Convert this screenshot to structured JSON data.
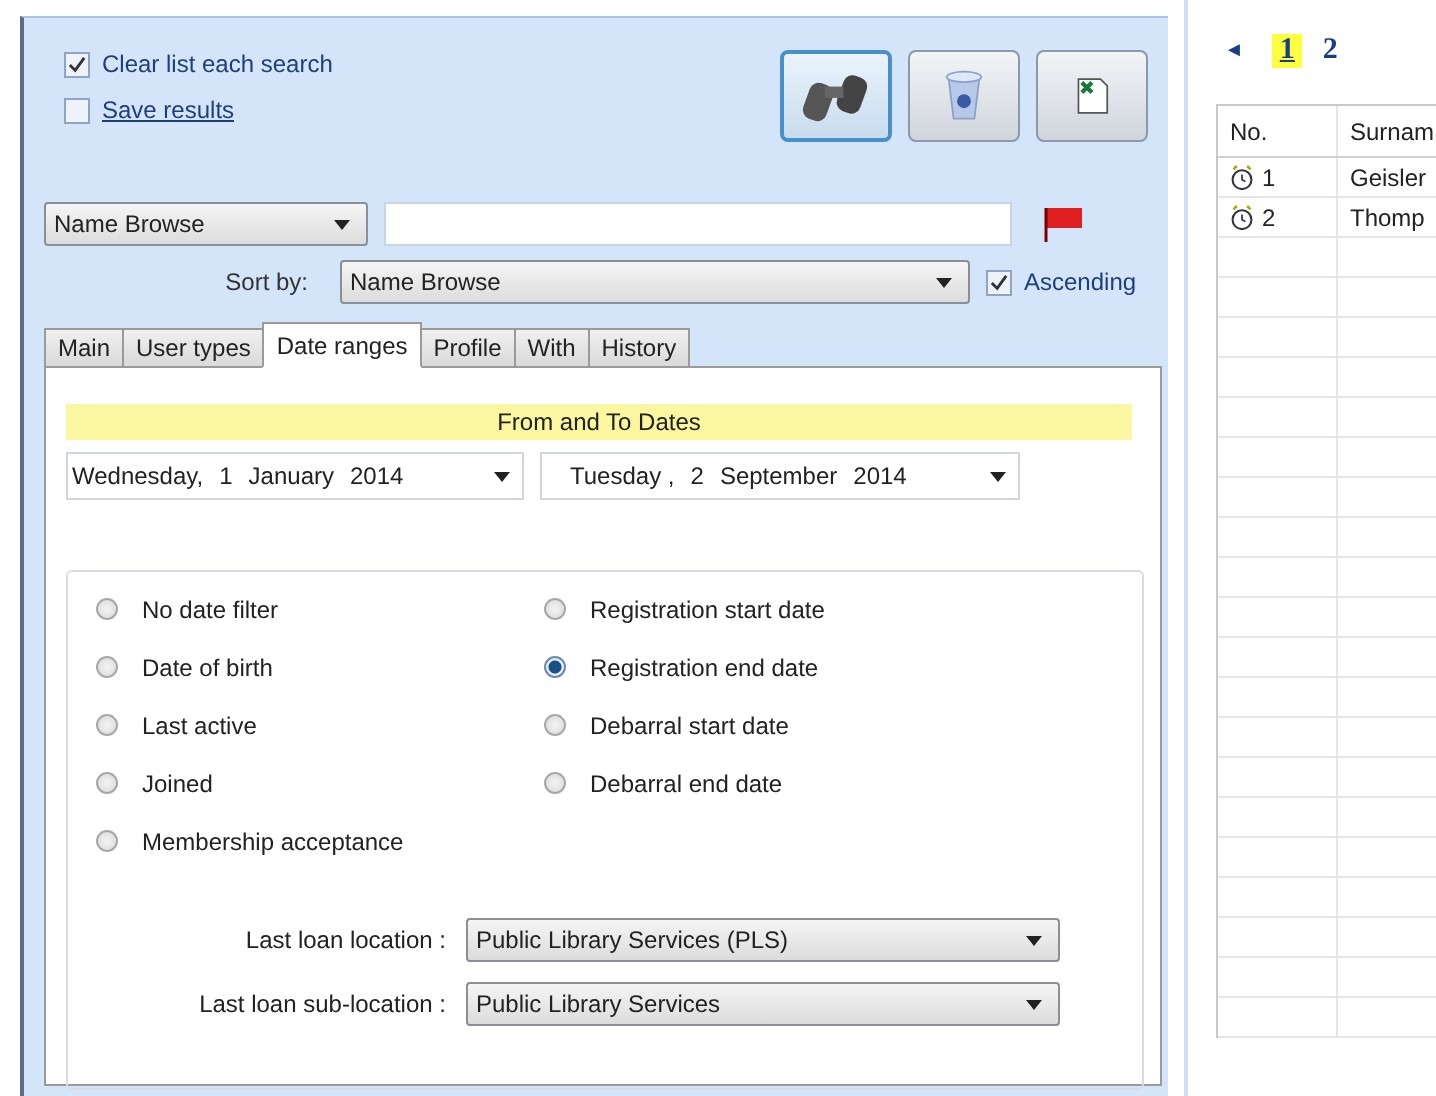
{
  "options": [
    {
      "label": "Clear list each search",
      "checked": true
    },
    {
      "label": "Save results",
      "checked": false
    }
  ],
  "toolbar": [
    {
      "kind": "binoculars",
      "selected": true
    },
    {
      "kind": "recycle",
      "selected": false
    },
    {
      "kind": "export",
      "selected": false
    }
  ],
  "search": {
    "type": "Name Browse"
  },
  "sort": {
    "label": "Sort by:",
    "value": "Name Browse",
    "ascending": {
      "label": "Ascending",
      "checked": true
    }
  },
  "tabs": [
    {
      "label": "Main",
      "selected": false
    },
    {
      "label": "User types",
      "selected": false
    },
    {
      "label": "Date ranges",
      "selected": true
    },
    {
      "label": "Profile",
      "selected": false
    },
    {
      "label": "With",
      "selected": false
    },
    {
      "label": "History",
      "selected": false
    }
  ],
  "date_header": "From and To Dates",
  "dates": [
    {
      "weekday": "Wednesday,",
      "day": "1",
      "month": "January",
      "year": "2014"
    },
    {
      "weekday": "Tuesday ,",
      "day": "2",
      "month": "September",
      "year": "2014"
    }
  ],
  "date_filters": [
    {
      "label": "No date filter",
      "selected": false
    },
    {
      "label": "Date of birth",
      "selected": false
    },
    {
      "label": "Last active",
      "selected": false
    },
    {
      "label": "Joined",
      "selected": false
    },
    {
      "label": "Membership acceptance",
      "selected": false
    },
    {
      "label": "Registration start date",
      "selected": false
    },
    {
      "label": "Registration end date",
      "selected": true
    },
    {
      "label": "Debarral start date",
      "selected": false
    },
    {
      "label": "Debarral end date",
      "selected": false
    }
  ],
  "locations": [
    {
      "label": "Last loan location :",
      "value": "Public Library Services (PLS)"
    },
    {
      "label": "Last loan sub-location :",
      "value": "Public Library Services"
    }
  ],
  "pager": {
    "prev": "◄",
    "pages": [
      {
        "label": "1",
        "selected": true
      },
      {
        "label": "2",
        "selected": false
      }
    ]
  },
  "results": {
    "columns": [
      "No.",
      "Surnam"
    ],
    "rows": [
      {
        "no": "1",
        "surname": "Geisler"
      },
      {
        "no": "2",
        "surname": "Thomp"
      }
    ]
  }
}
